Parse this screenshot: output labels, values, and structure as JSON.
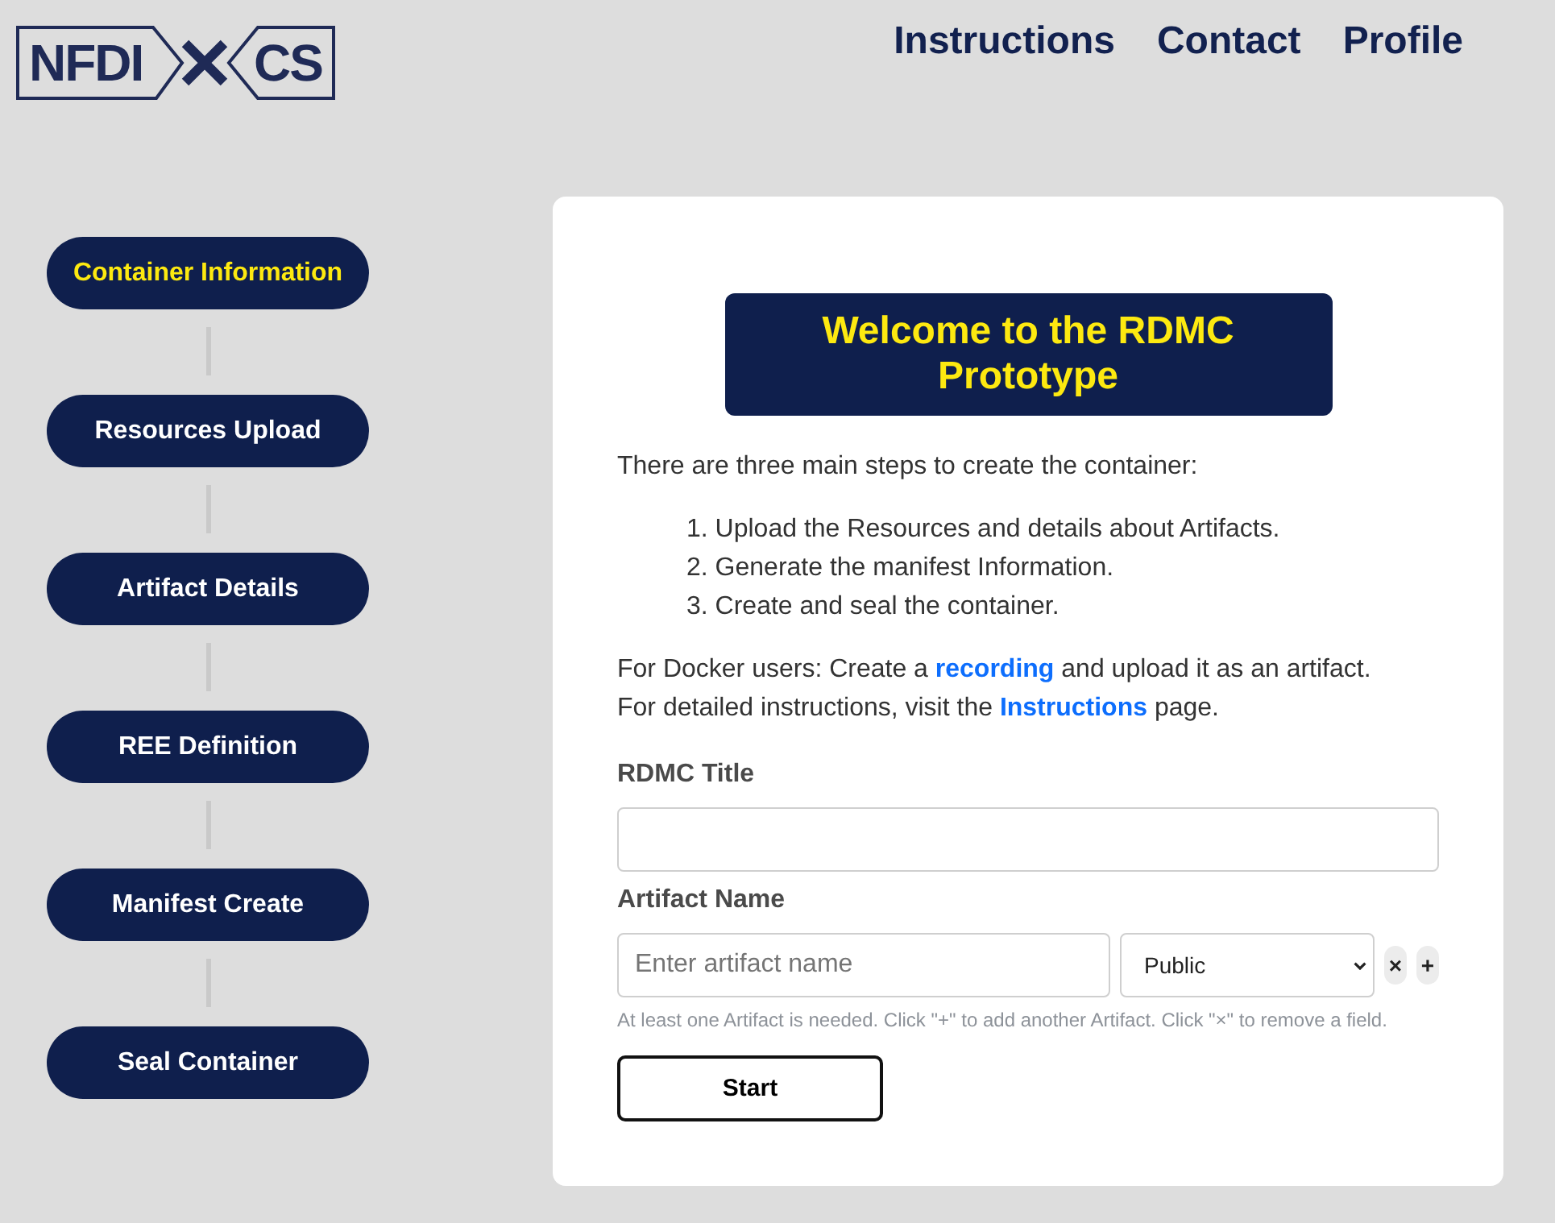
{
  "header": {
    "logo": {
      "left_text": "NFDI",
      "right_text": "CS"
    },
    "nav": [
      {
        "label": "Instructions"
      },
      {
        "label": "Contact"
      },
      {
        "label": "Profile"
      }
    ]
  },
  "steps": [
    {
      "label": "Container Information",
      "selected": true
    },
    {
      "label": "Resources Upload",
      "selected": false
    },
    {
      "label": "Artifact Details",
      "selected": false
    },
    {
      "label": "REE Definition",
      "selected": false
    },
    {
      "label": "Manifest Create",
      "selected": false
    },
    {
      "label": "Seal Container",
      "selected": false
    }
  ],
  "card": {
    "title": "Welcome to the RDMC Prototype",
    "intro": "There are three main steps to create the container:",
    "steps_list": [
      {
        "number": "1.",
        "text": "Upload the Resources and details about Artifacts."
      },
      {
        "number": "2.",
        "text": "Generate the manifest Information."
      },
      {
        "number": "3.",
        "text": "Create and seal the container."
      }
    ],
    "notes": [
      {
        "before": "For Docker users: Create a",
        "link": "recording",
        "after": "and upload it as an artifact."
      },
      {
        "before": "For detailed instructions, visit the",
        "link": "Instructions",
        "after": "page."
      }
    ],
    "form": {
      "title_field": {
        "label": "RDMC Title"
      },
      "artifact": {
        "label": "Artifact Name",
        "name_field": {
          "placeholder": "Enter artifact name"
        },
        "visibility_select": {
          "value": "Public"
        },
        "remove_button": "×",
        "add_button": "+",
        "hint": "At least one Artifact is needed. Click \"+\" to add another Artifact. Click \"×\" to remove a field."
      },
      "start_button": "Start"
    }
  }
}
